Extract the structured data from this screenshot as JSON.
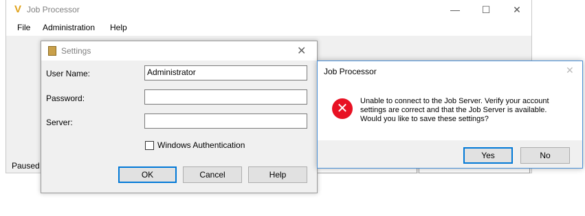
{
  "main_window": {
    "title": "Job Processor",
    "minimize_glyph": "—",
    "maximize_glyph": "☐",
    "close_glyph": "✕",
    "menu": [
      "File",
      "Administration",
      "Help"
    ],
    "status": "Paused"
  },
  "settings_dialog": {
    "title": "Settings",
    "close_glyph": "✕",
    "user_name_label": "User Name:",
    "user_name_value": "Administrator",
    "password_label": "Password:",
    "password_value": "",
    "server_label": "Server:",
    "server_value": "",
    "windows_auth_label": "Windows Authentication",
    "windows_auth_checked": false,
    "ok_label": "OK",
    "cancel_label": "Cancel",
    "help_label": "Help"
  },
  "error_dialog": {
    "title": "Job Processor",
    "close_glyph": "✕",
    "icon_glyph": "✕",
    "message_lines": [
      "Unable to connect to the Job Server. Verify your account",
      "settings are correct and that the Job Server is available.",
      "Would you like to save these settings?"
    ],
    "yes_label": "Yes",
    "no_label": "No"
  },
  "colors": {
    "accent": "#0078d7",
    "error": "#e81123",
    "logo": "#e0a21a"
  },
  "icons": {
    "app_logo": "vault-logo-icon",
    "settings_icon": "settings-app-icon",
    "error_icon": "error-icon"
  }
}
